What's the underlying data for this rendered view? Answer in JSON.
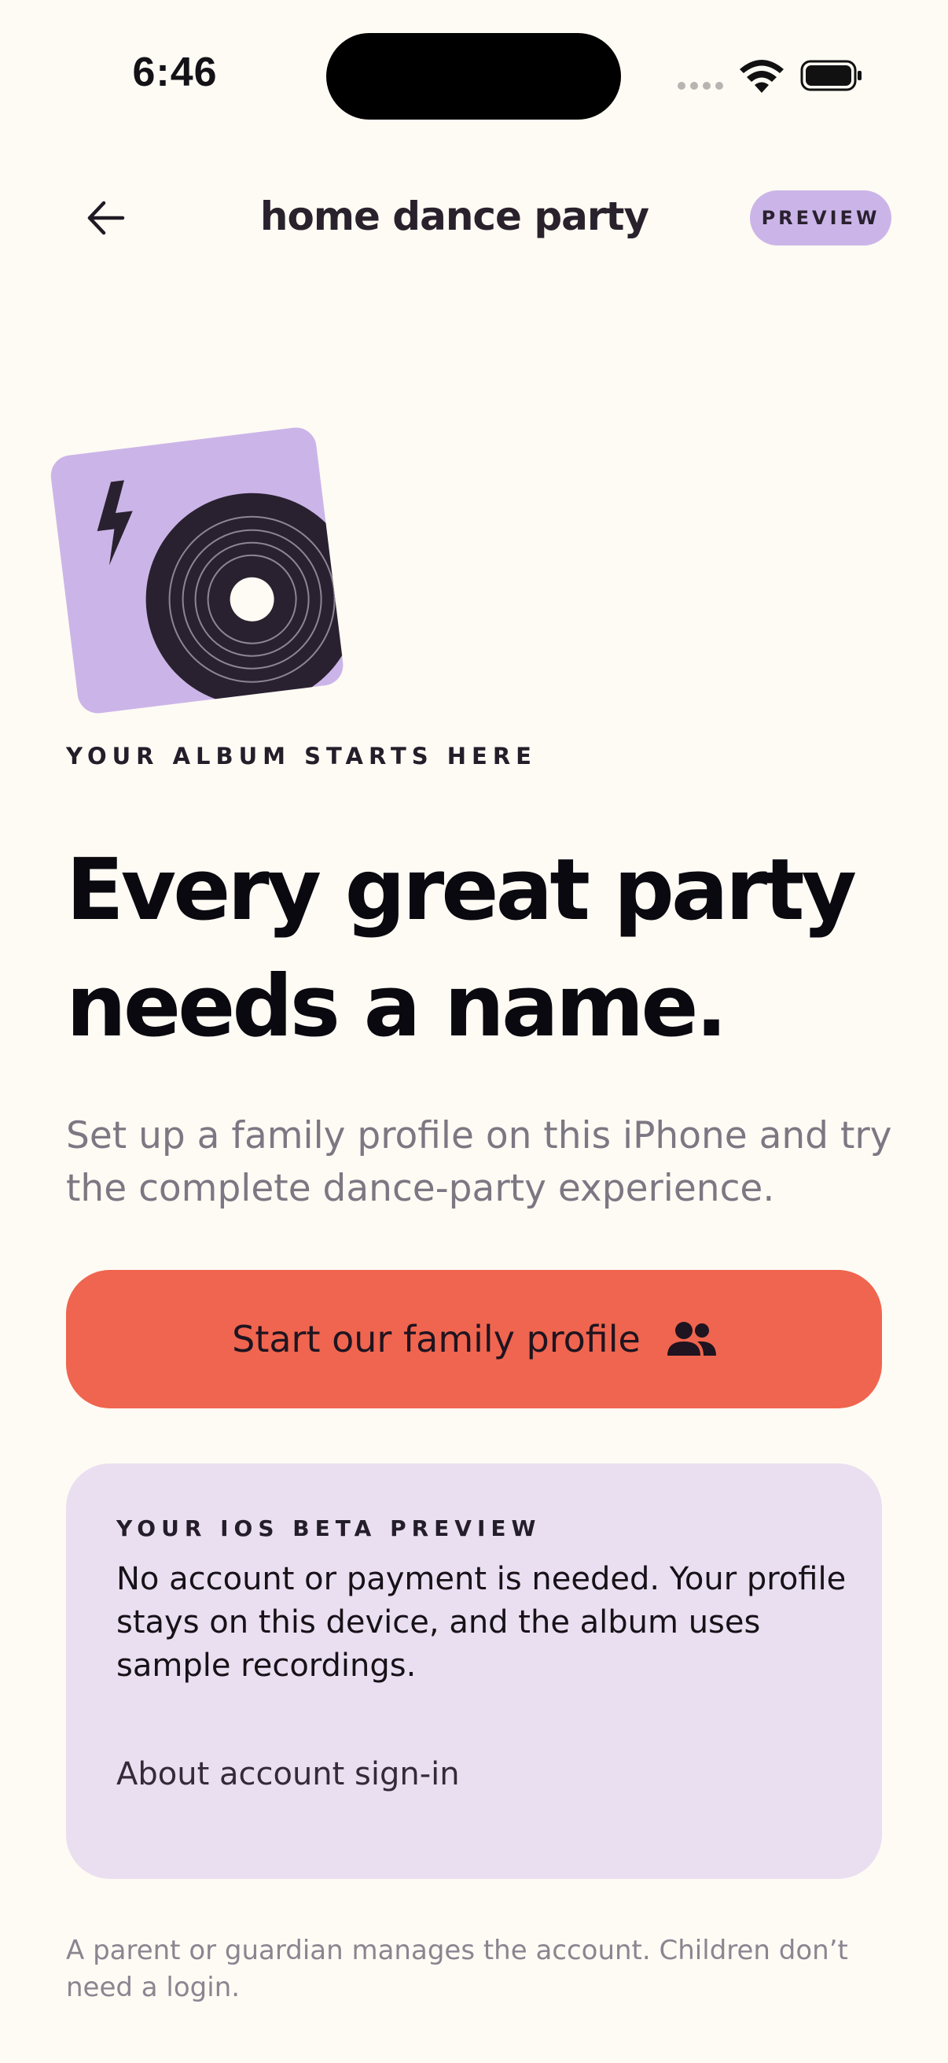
{
  "status_bar": {
    "time": "6:46"
  },
  "nav": {
    "title": "home dance party",
    "badge": "PREVIEW"
  },
  "eyebrow": "YOUR ALBUM STARTS HERE",
  "headline": {
    "line1": "Every great party",
    "line2": "needs a name."
  },
  "subtext": "Set up a family profile on this iPhone and try the complete dance-party experience.",
  "primary_button": {
    "label": "Start our family profile",
    "icon": "people-icon"
  },
  "info_card": {
    "eyebrow": "YOUR IOS BETA PREVIEW",
    "body": "No account or payment is needed. Your profile stays on this device, and the album uses sample recordings.",
    "link": "About account sign-in"
  },
  "footnote": "A parent or guardian manages the account. Children don’t need a login.",
  "colors": {
    "background": "#FEFBF4",
    "accent": "#F0654F",
    "lavender": "#CBB5E8",
    "card": "#EADFF0",
    "ink": "#0B0910"
  }
}
